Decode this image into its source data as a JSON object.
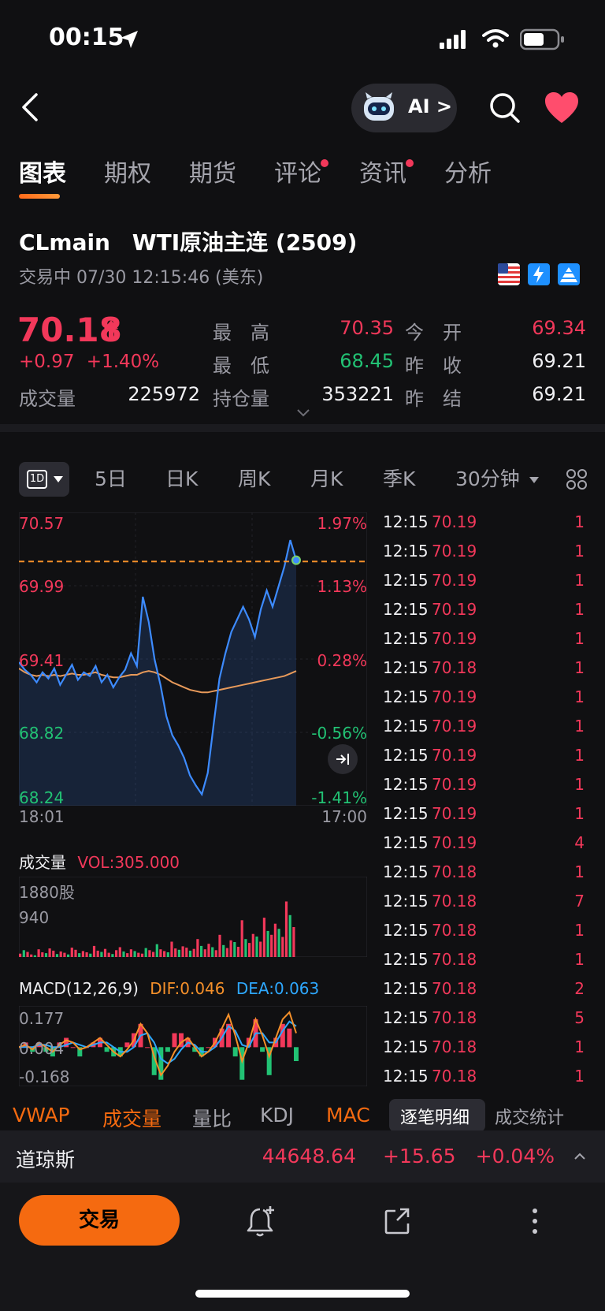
{
  "status": {
    "time": "00:15"
  },
  "nav": {
    "ai_label": "AI >"
  },
  "tabs": [
    {
      "label": "图表",
      "active": true,
      "dot": false
    },
    {
      "label": "期权",
      "active": false,
      "dot": false
    },
    {
      "label": "期货",
      "active": false,
      "dot": false
    },
    {
      "label": "评论",
      "active": false,
      "dot": true
    },
    {
      "label": "资讯",
      "active": false,
      "dot": true
    },
    {
      "label": "分析",
      "active": false,
      "dot": false
    }
  ],
  "instrument": {
    "symbol": "CLmain",
    "name": "WTI原油主连 (2509)",
    "session": "交易中 07/30 12:15:46 (美东)",
    "price": "70.18",
    "change": "+0.97",
    "change_pct": "+1.40%"
  },
  "stats": {
    "high_label": "最　高",
    "high": "70.35",
    "low_label": "最　低",
    "low": "68.45",
    "open_label": "今　开",
    "open": "69.34",
    "prev_close_label": "昨　收",
    "prev_close": "69.21",
    "prev_settle_label": "昨　结",
    "prev_settle": "69.21",
    "volume_label": "成交量",
    "volume": "225972",
    "oi_label": "持仓量",
    "oi": "353221"
  },
  "periods": {
    "oneday": "1D",
    "items": [
      "5日",
      "日K",
      "周K",
      "月K",
      "季K",
      "30分钟"
    ]
  },
  "chart_data": {
    "type": "line",
    "series": [
      {
        "values": [
          69.38,
          69.32,
          69.28,
          69.22,
          69.3,
          69.25,
          69.33,
          69.2,
          69.28,
          69.36,
          69.24,
          69.3,
          69.27,
          69.35,
          69.22,
          69.28,
          69.18,
          69.26,
          69.32,
          69.45,
          69.35,
          69.9,
          69.7,
          69.4,
          69.2,
          68.95,
          68.8,
          68.72,
          68.62,
          68.48,
          68.4,
          68.33,
          68.5,
          68.88,
          69.25,
          69.45,
          69.62,
          69.72,
          69.82,
          69.72,
          69.58,
          69.8,
          69.95,
          69.82,
          69.98,
          70.14,
          70.35,
          70.19
        ]
      },
      {
        "values": [
          69.33,
          69.3,
          69.28,
          69.27,
          69.28,
          69.27,
          69.28,
          69.27,
          69.28,
          69.29,
          69.28,
          69.28,
          69.29,
          69.3,
          69.28,
          69.27,
          69.26,
          69.26,
          69.27,
          69.28,
          69.28,
          69.3,
          69.31,
          69.3,
          69.28,
          69.25,
          69.22,
          69.2,
          69.18,
          69.16,
          69.15,
          69.14,
          69.14,
          69.15,
          69.16,
          69.17,
          69.18,
          69.19,
          69.2,
          69.21,
          69.22,
          69.23,
          69.24,
          69.25,
          69.26,
          69.27,
          69.29,
          69.31
        ]
      }
    ],
    "y_labels_left": [
      "70.57",
      "69.99",
      "69.41",
      "68.82",
      "68.24"
    ],
    "y_labels_right": [
      "1.97%",
      "1.13%",
      "0.28%",
      "-0.56%",
      "-1.41%"
    ],
    "x_labels": [
      "18:01",
      "17:00"
    ],
    "ylim": [
      68.24,
      70.57
    ],
    "ref_line": 70.18
  },
  "volume": {
    "title": "成交量",
    "vol_text": "VOL:305.000",
    "top_label": "1880股",
    "mid_label": "940",
    "values": [
      80,
      160,
      120,
      60,
      40,
      180,
      110,
      90,
      200,
      150,
      70,
      130,
      100,
      60,
      220,
      170,
      90,
      140,
      110,
      80,
      260,
      150,
      120,
      190,
      100,
      70,
      160,
      230,
      130,
      90,
      180,
      140,
      100,
      80,
      210,
      160,
      120,
      300,
      180,
      140,
      110,
      360,
      200,
      170,
      250,
      220,
      150,
      190,
      420,
      260,
      180,
      310,
      230,
      160,
      520,
      280,
      210,
      390,
      350,
      240,
      860,
      420,
      330,
      540,
      480,
      360,
      920,
      610,
      520,
      780,
      660,
      470,
      1300,
      980,
      700
    ]
  },
  "macd": {
    "title": "MACD(12,26,9)",
    "dif_text": "DIF:0.046",
    "dea_text": "DEA:0.063",
    "labels": [
      "0.177",
      "0.004",
      "-0.168"
    ],
    "dif": [
      0.0,
      0.01,
      -0.01,
      0.02,
      0.0,
      -0.02,
      0.01,
      0.03,
      0.02,
      -0.01,
      0.0,
      0.02,
      0.04,
      0.01,
      -0.02,
      -0.04,
      -0.01,
      0.03,
      0.1,
      0.06,
      -0.04,
      -0.12,
      -0.08,
      -0.02,
      0.02,
      0.04,
      0.0,
      -0.04,
      -0.02,
      0.02,
      0.08,
      0.14,
      0.05,
      -0.06,
      0.02,
      0.12,
      0.05,
      -0.04,
      0.04,
      0.12,
      0.15,
      0.06
    ],
    "dea": [
      0.0,
      0.0,
      0.0,
      0.01,
      0.01,
      0.0,
      0.0,
      0.01,
      0.02,
      0.01,
      0.0,
      0.01,
      0.02,
      0.02,
      0.0,
      -0.02,
      -0.02,
      0.0,
      0.05,
      0.06,
      0.02,
      -0.05,
      -0.07,
      -0.05,
      -0.01,
      0.02,
      0.01,
      -0.02,
      -0.02,
      0.0,
      0.04,
      0.09,
      0.07,
      0.01,
      0.0,
      0.06,
      0.06,
      0.02,
      0.02,
      0.07,
      0.11,
      0.09
    ]
  },
  "ticks": [
    {
      "time": "12:15",
      "price": "70.19",
      "qty": "1"
    },
    {
      "time": "12:15",
      "price": "70.19",
      "qty": "1"
    },
    {
      "time": "12:15",
      "price": "70.19",
      "qty": "1"
    },
    {
      "time": "12:15",
      "price": "70.19",
      "qty": "1"
    },
    {
      "time": "12:15",
      "price": "70.19",
      "qty": "1"
    },
    {
      "time": "12:15",
      "price": "70.18",
      "qty": "1"
    },
    {
      "time": "12:15",
      "price": "70.19",
      "qty": "1"
    },
    {
      "time": "12:15",
      "price": "70.19",
      "qty": "1"
    },
    {
      "time": "12:15",
      "price": "70.19",
      "qty": "1"
    },
    {
      "time": "12:15",
      "price": "70.19",
      "qty": "1"
    },
    {
      "time": "12:15",
      "price": "70.19",
      "qty": "1"
    },
    {
      "time": "12:15",
      "price": "70.19",
      "qty": "4"
    },
    {
      "time": "12:15",
      "price": "70.18",
      "qty": "1"
    },
    {
      "time": "12:15",
      "price": "70.18",
      "qty": "7"
    },
    {
      "time": "12:15",
      "price": "70.18",
      "qty": "1"
    },
    {
      "time": "12:15",
      "price": "70.18",
      "qty": "1"
    },
    {
      "time": "12:15",
      "price": "70.18",
      "qty": "2"
    },
    {
      "time": "12:15",
      "price": "70.18",
      "qty": "5"
    },
    {
      "time": "12:15",
      "price": "70.18",
      "qty": "1"
    },
    {
      "time": "12:15",
      "price": "70.18",
      "qty": "1"
    }
  ],
  "indicators": [
    "VWAP",
    "成交量",
    "量比",
    "KDJ",
    "MAC"
  ],
  "detail_tabs": [
    "逐笔明细",
    "成交统计"
  ],
  "index_bar": {
    "name": "道琼斯",
    "value": "44648.64",
    "change": "+15.65",
    "pct": "+0.04%"
  },
  "actions": {
    "trade": "交易"
  },
  "colors": {
    "accent": "#f56a10",
    "up": "#f2385a",
    "down": "#22c274",
    "line": "#3d8bff",
    "avg": "#e89a5a"
  }
}
